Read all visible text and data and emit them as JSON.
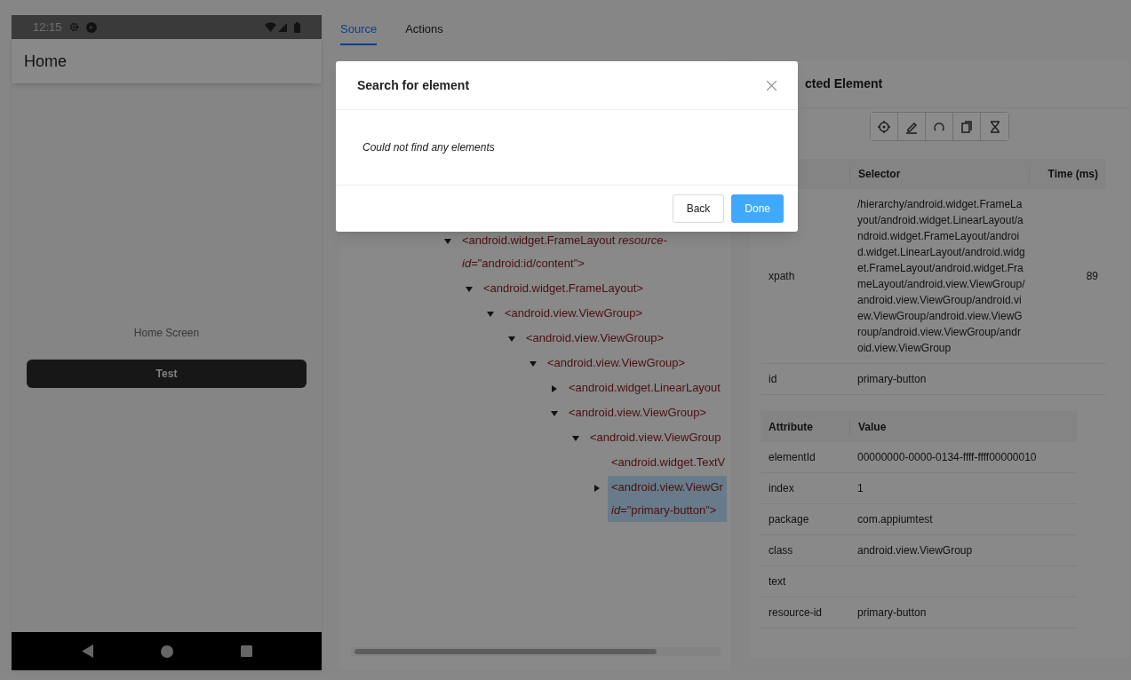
{
  "device": {
    "time": "12:15",
    "app_title": "Home",
    "screen_text": "Home Screen",
    "button_label": "Test"
  },
  "tabs": [
    {
      "label": "Source",
      "selected": true
    },
    {
      "label": "Actions",
      "selected": false
    }
  ],
  "source_tree": [
    {
      "lines": [
        "<android.widget.FrameLayout *resource-*",
        "*id*=\"android:id/content\">"
      ],
      "expanded": true,
      "selected": false,
      "children": [
        {
          "lines": [
            "<android.widget.FrameLayout>"
          ],
          "expanded": true,
          "selected": false,
          "children": [
            {
              "lines": [
                "<android.view.ViewGroup>"
              ],
              "expanded": true,
              "selected": false,
              "children": [
                {
                  "lines": [
                    "<android.view.ViewGroup>"
                  ],
                  "expanded": true,
                  "selected": false,
                  "children": [
                    {
                      "lines": [
                        "<android.view.ViewGroup>"
                      ],
                      "expanded": true,
                      "selected": false,
                      "children": [
                        {
                          "lines": [
                            "<android.widget.LinearLayout"
                          ],
                          "expanded": false,
                          "selected": false
                        },
                        {
                          "lines": [
                            "<android.view.ViewGroup>"
                          ],
                          "expanded": true,
                          "selected": false,
                          "children": [
                            {
                              "lines": [
                                "<android.view.ViewGroup"
                              ],
                              "expanded": true,
                              "selected": false,
                              "children": [
                                {
                                  "lines": [
                                    "<android.widget.TextV"
                                  ],
                                  "selected": false
                                },
                                {
                                  "lines": [
                                    "<android.view.ViewGr",
                                    "*id*=\"primary-button\">"
                                  ],
                                  "expanded": false,
                                  "selected": true
                                }
                              ]
                            }
                          ]
                        }
                      ]
                    }
                  ]
                }
              ]
            }
          ]
        }
      ]
    }
  ],
  "selected_element": {
    "title": "cted Element",
    "selector_table": {
      "columns": [
        "Selector",
        "Time (ms)"
      ],
      "rows": [
        {
          "strategy": "xpath",
          "selector": "/hierarchy/android.widget.FrameLayout/android.widget.LinearLayout/android.widget.FrameLayout/android.widget.LinearLayout/android.widget.FrameLayout/android.widget.FrameLayout/android.view.ViewGroup/android.view.ViewGroup/android.view.ViewGroup/android.view.ViewGroup/android.view.ViewGroup/android.view.ViewGroup",
          "time": "89"
        },
        {
          "strategy": "id",
          "selector": "primary-button"
        }
      ]
    },
    "attribute_table": {
      "columns": [
        "Attribute",
        "Value"
      ],
      "rows": [
        {
          "name": "elementId",
          "value": "00000000-0000-0134-ffff-ffff00000010"
        },
        {
          "name": "index",
          "value": "1"
        },
        {
          "name": "package",
          "value": "com.appiumtest"
        },
        {
          "name": "class",
          "value": "android.view.ViewGroup"
        },
        {
          "name": "text"
        },
        {
          "name": "resource-id",
          "value": "primary-button"
        }
      ]
    }
  },
  "dialog": {
    "title": "Search for element",
    "message": "Could not find any elements",
    "buttons": [
      {
        "label": "Back",
        "kind": "default"
      },
      {
        "label": "Done",
        "kind": "primary"
      }
    ]
  }
}
